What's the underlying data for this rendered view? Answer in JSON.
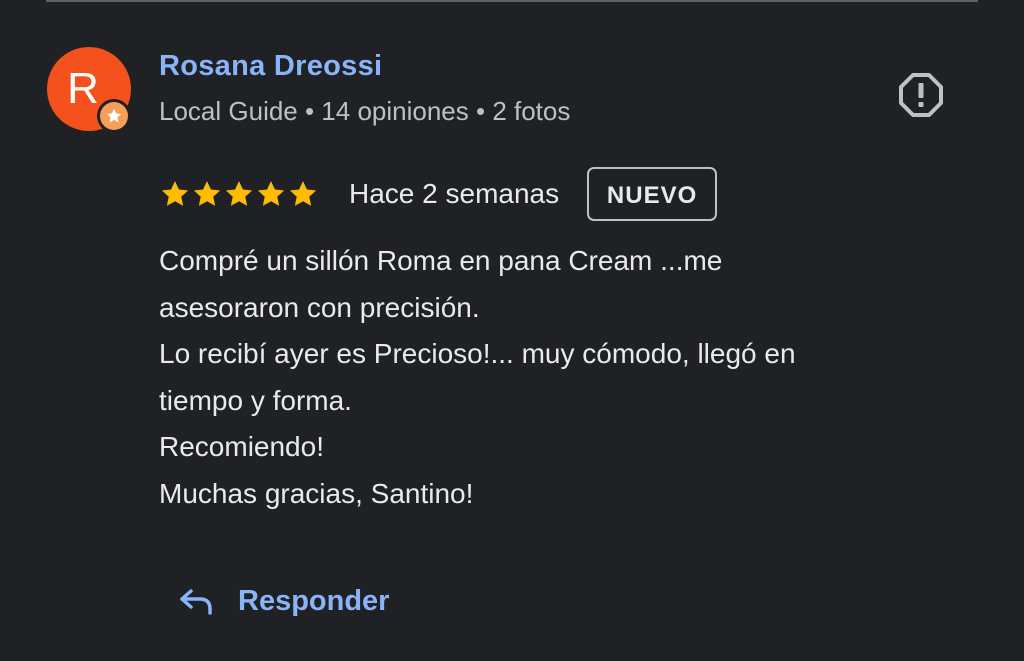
{
  "review": {
    "reviewer": {
      "initial": "R",
      "name": "Rosana Dreossi",
      "meta": "Local Guide • 14 opiniones • 2 fotos",
      "avatar_color": "#f4511e"
    },
    "rating": {
      "stars": 5,
      "max_stars": 5,
      "star_color": "#fbbc04"
    },
    "date": "Hace 2 semanas",
    "badge": "NUEVO",
    "text_lines": [
      "Compré un sillón Roma en pana Cream ...me",
      "asesoraron con precisión.",
      "Lo recibí ayer es Precioso!... muy cómodo, llegó en",
      "tiempo y forma.",
      "Recomiendo!",
      "Muchas gracias, Santino!"
    ],
    "actions": {
      "reply_label": "Responder",
      "reply_icon": "reply-arrow-icon",
      "report_icon": "report-icon"
    }
  },
  "theme": {
    "background": "#202124",
    "link_color": "#8ab4f8",
    "text_color": "#e8eaed",
    "secondary_text": "#bdc1c6"
  }
}
